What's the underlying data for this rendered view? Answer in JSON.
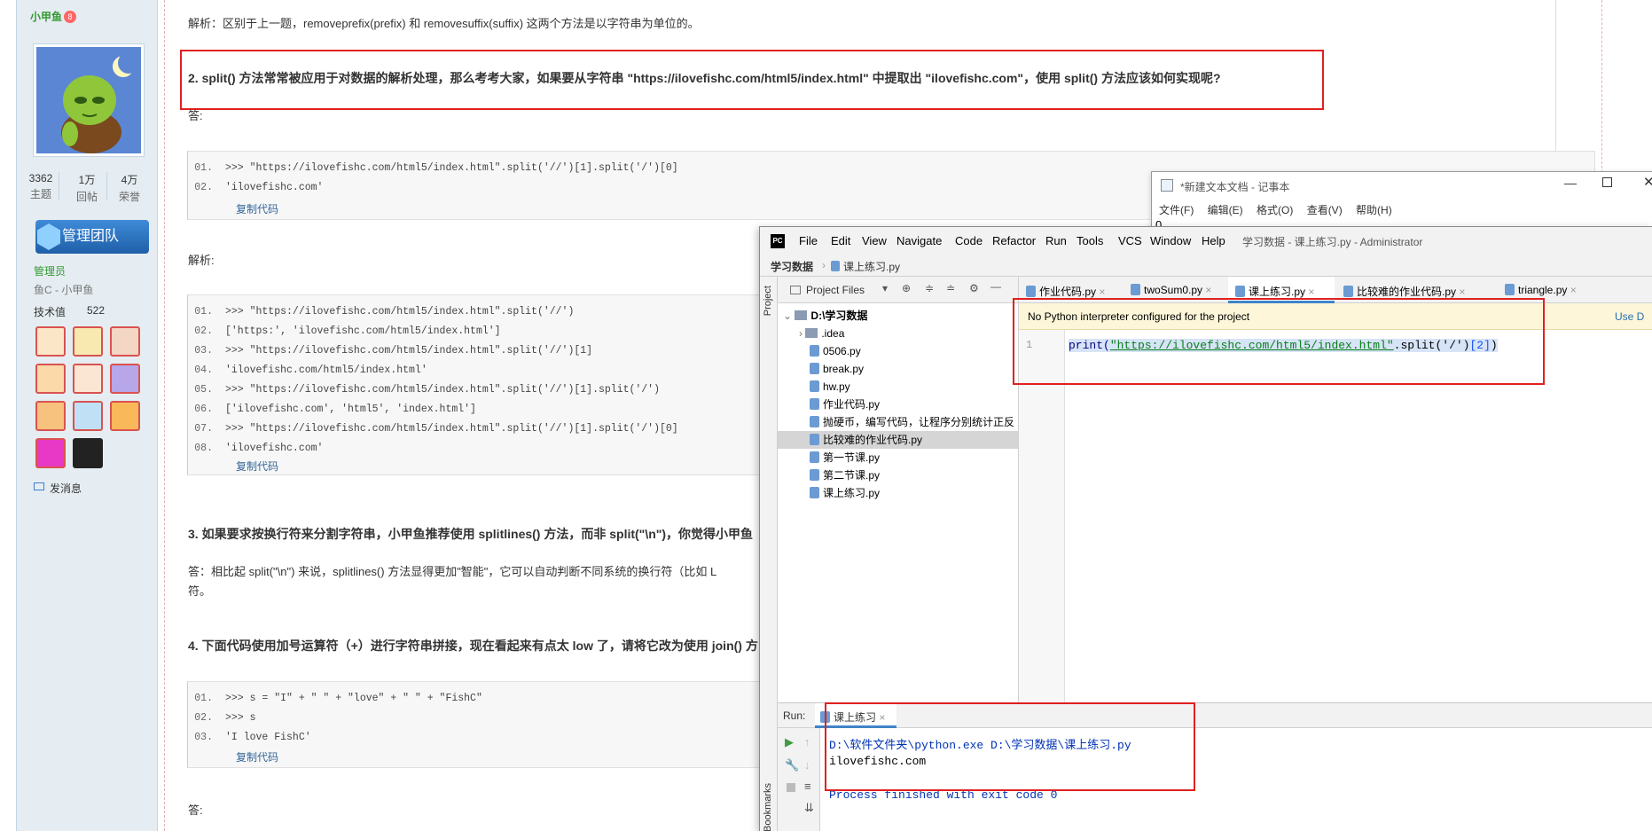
{
  "forum_user": {
    "name": "小甲鱼",
    "badge": "8",
    "stats": [
      {
        "value": "3362",
        "label": "主题"
      },
      {
        "value": "1万",
        "label": "回帖"
      },
      {
        "value": "4万",
        "label": "荣誉"
      }
    ],
    "team_banner": "管理团队",
    "role": "管理员",
    "subname": "鱼C - 小甲鱼",
    "tech_label": "技术值",
    "tech_value": "522",
    "send_message": "发消息"
  },
  "post": {
    "analysis_prev": "解析：区别于上一题，removeprefix(prefix) 和 removesuffix(suffix) 这两个方法是以字符串为单位的。",
    "q2": "2. split() 方法常常被应用于对数据的解析处理，那么考考大家，如果要从字符串 \"https://ilovefishc.com/html5/index.html\" 中提取出 \"ilovefishc.com\"，使用 split() 方法应该如何实现呢?",
    "answer_label": "答:",
    "code1": [
      {
        "n": "01.",
        "t": ">>> \"https://ilovefishc.com/html5/index.html\".split('//')[1].split('/')[0]"
      },
      {
        "n": "02.",
        "t": "'ilovefishc.com'"
      }
    ],
    "copy_code": "复制代码",
    "analysis_label": "解析:",
    "code2": [
      {
        "n": "01.",
        "t": ">>> \"https://ilovefishc.com/html5/index.html\".split('//')"
      },
      {
        "n": "02.",
        "t": "['https:', 'ilovefishc.com/html5/index.html']"
      },
      {
        "n": "03.",
        "t": ">>> \"https://ilovefishc.com/html5/index.html\".split('//')[1]"
      },
      {
        "n": "04.",
        "t": "'ilovefishc.com/html5/index.html'"
      },
      {
        "n": "05.",
        "t": ">>> \"https://ilovefishc.com/html5/index.html\".split('//')[1].split('/')"
      },
      {
        "n": "06.",
        "t": "['ilovefishc.com', 'html5', 'index.html']"
      },
      {
        "n": "07.",
        "t": ">>> \"https://ilovefishc.com/html5/index.html\".split('//')[1].split('/')[0]"
      },
      {
        "n": "08.",
        "t": "'ilovefishc.com'"
      }
    ],
    "q3": "3. 如果要求按换行符来分割字符串，小甲鱼推荐使用 splitlines() 方法，而非 split(\"\\n\")，你觉得小甲鱼",
    "a3_line1": "答：相比起 split(\"\\n\") 来说，splitlines() 方法显得更加\"智能\"，它可以自动判断不同系统的换行符（比如 L",
    "a3_line2": "符。",
    "q4": "4. 下面代码使用加号运算符（+）进行字符串拼接，现在看起来有点太 low 了，请将它改为使用 join() 方",
    "code3": [
      {
        "n": "01.",
        "t": ">>> s = \"I\" + \" \" + \"love\" + \" \" + \"FishC\""
      },
      {
        "n": "02.",
        "t": ">>> s"
      },
      {
        "n": "03.",
        "t": "'I love FishC'"
      }
    ],
    "answer_label2": "答:"
  },
  "notepad": {
    "title": "*新建文本文档 - 记事本",
    "menu": [
      "文件(F)",
      "编辑(E)",
      "格式(O)",
      "查看(V)",
      "帮助(H)"
    ],
    "content": "0"
  },
  "pycharm": {
    "logo": "PC",
    "menu": [
      "File",
      "Edit",
      "View",
      "Navigate",
      "Code",
      "Refactor",
      "Run",
      "Tools",
      "VCS",
      "Window",
      "Help"
    ],
    "title": "学习数据 - 课上练习.py - Administrator",
    "breadcrumb_root": "学习数据",
    "breadcrumb_file": "课上练习.py",
    "left_strip_top": "Project",
    "left_strip_bottom": "Bookmarks",
    "project_dropdown": "Project Files",
    "tree_root": "D:\\学习数据",
    "tree": [
      ".idea",
      "0506.py",
      "break.py",
      "hw.py",
      "作业代码.py",
      "抛硬币，编写代码，让程序分别统计正反",
      "比较难的作业代码.py",
      "第一节课.py",
      "第二节课.py",
      "课上练习.py"
    ],
    "tabs": [
      "作业代码.py",
      "twoSum0.py",
      "课上练习.py",
      "比较难的作业代码.py",
      "triangle.py"
    ],
    "banner": "No Python interpreter configured for the project",
    "banner_action": "Use D",
    "line_no": "1",
    "code": {
      "fn": "print(",
      "str": "\"https://ilovefishc.com/html5/index.html\"",
      "mid": ".split('/')",
      "idx": "[2]",
      "end": ")"
    },
    "run_label": "Run:",
    "run_tab": "课上练习",
    "run_cmd": "D:\\软件文件夹\\python.exe D:\\学习数据\\课上练习.py",
    "run_output": "ilovefishc.com",
    "run_exit": "Process finished with exit code 0"
  },
  "colors": {
    "highlight_box": "#e02020",
    "forum_green": "#339933",
    "link_blue": "#336699"
  }
}
